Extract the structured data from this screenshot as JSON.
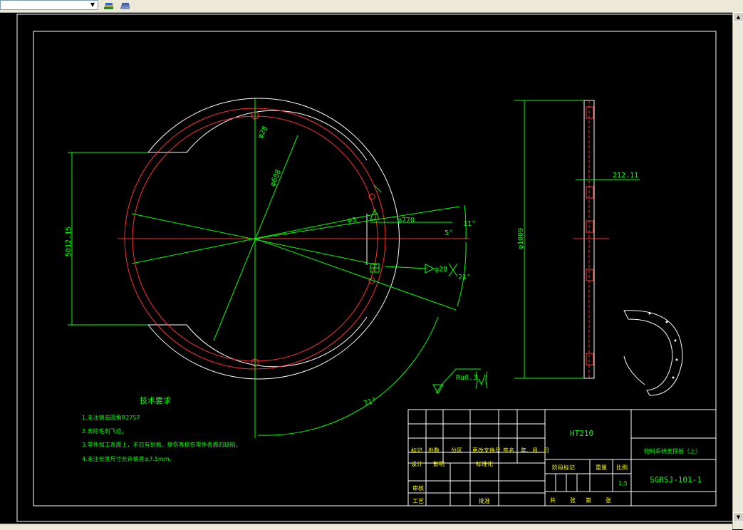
{
  "toolbar": {
    "layer_combo_value": "",
    "icons": [
      "layer-states-icon",
      "layer-previous-icon"
    ]
  },
  "drawing": {
    "colors": {
      "background": "#000000",
      "outline": "#ffffff",
      "dimension": "#00ff00",
      "hidden": "#ff0000",
      "text_yellow": "#ffff00"
    },
    "dimensions": {
      "phi28_top": "φ28",
      "phi688": "φ688",
      "phi5": "φ5",
      "phi770": "φ770",
      "angle_11": "11°",
      "angle_5": "5°",
      "angle_21": "21°",
      "phi28_right": "φ28",
      "angle_71": "71°",
      "width_left": "5012.15",
      "side_height": "φ1009",
      "side_thickness": "212.11",
      "roughness": "Ra6.3"
    },
    "tech_requirements": {
      "title": "技术要求",
      "items": [
        "1.未注铸造圆角R2757",
        "2.去除毛刺飞边。",
        "3.零件加工表面上，不应有划痕、擦伤等损伤零件表面的缺陷。",
        "4.未注长度尺寸允许偏差±7.5mm。"
      ]
    },
    "title_block": {
      "material": "HT210",
      "part_name": "物料系统支撑板（上）",
      "drawing_number": "SGRSJ-101-1",
      "scale_value": "1:5",
      "row_labels": [
        "标记",
        "处数",
        "分区",
        "更改文件号",
        "签名",
        "年、月、日"
      ],
      "design_label": "设计",
      "design_name": "彭明",
      "standardize_label": "标准化",
      "review_label": "审核",
      "process_label": "工艺",
      "approve_label": "批准",
      "stage_label": "阶段标记",
      "weight_label": "重量",
      "scale_label": "比例",
      "sheets_label": "共",
      "sheets_of": "张",
      "sheet_label": "第",
      "sheet_of": "张"
    }
  }
}
